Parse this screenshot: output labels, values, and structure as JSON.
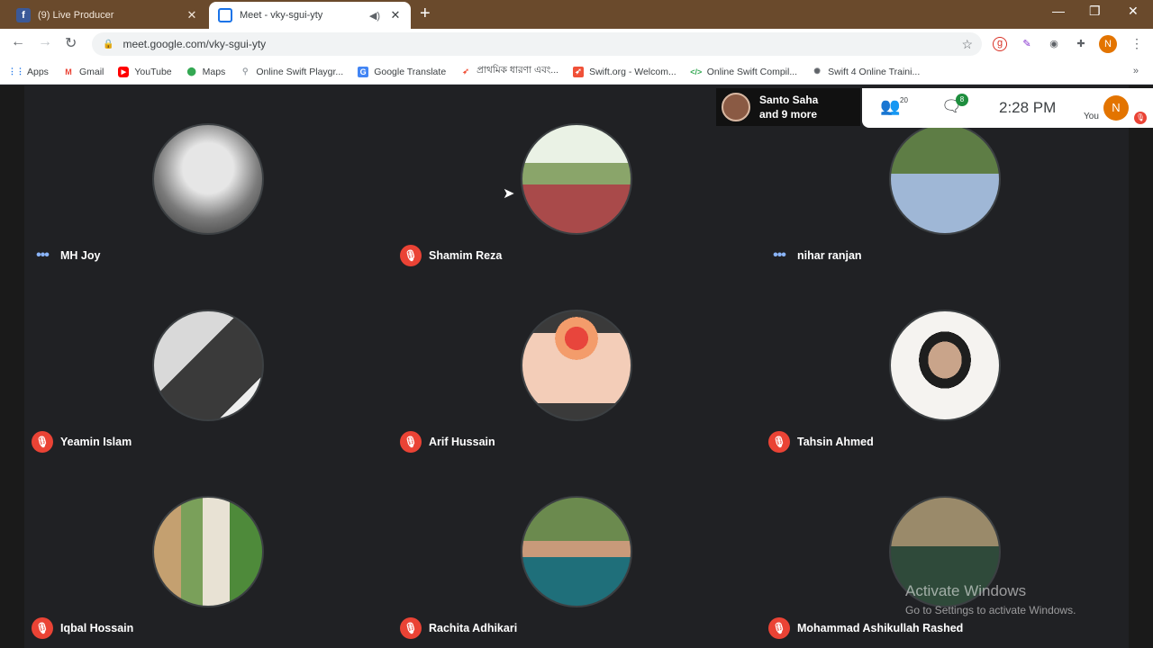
{
  "browser": {
    "tabs": [
      {
        "title": "(9) Live Producer",
        "active": false
      },
      {
        "title": "Meet - vky-sgui-yty",
        "active": true
      }
    ],
    "url": "meet.google.com/vky-sgui-yty",
    "profile_initial": "N",
    "bookmarks": [
      {
        "label": "Apps",
        "icon": "apps-grid-icon"
      },
      {
        "label": "Gmail",
        "icon": "gmail-icon"
      },
      {
        "label": "YouTube",
        "icon": "youtube-icon"
      },
      {
        "label": "Maps",
        "icon": "maps-pin-icon"
      },
      {
        "label": "Online Swift Playgr...",
        "icon": "pin-icon"
      },
      {
        "label": "Google Translate",
        "icon": "translate-icon"
      },
      {
        "label": "প্রাথমিক ধারণা এবং...",
        "icon": "swift-icon"
      },
      {
        "label": "Swift.org - Welcom...",
        "icon": "swift-org-icon"
      },
      {
        "label": "Online Swift Compil...",
        "icon": "code-icon"
      },
      {
        "label": "Swift 4 Online Traini...",
        "icon": "gear-icon"
      }
    ]
  },
  "meet": {
    "presenter": {
      "name": "Santo Saha",
      "more": "and 9 more"
    },
    "people_count": "20",
    "chat_badge": "8",
    "time": "2:28 PM",
    "you_label": "You",
    "you_initial": "N",
    "participants": [
      {
        "name": "MH Joy",
        "status": "speaking",
        "color": "#9a9a9a"
      },
      {
        "name": "Shamim Reza",
        "status": "muted",
        "color": "#7b8f5a"
      },
      {
        "name": "nihar ranjan",
        "status": "speaking",
        "color": "#6f8c52"
      },
      {
        "name": "Yeamin Islam",
        "status": "muted",
        "color": "#bdbdbd"
      },
      {
        "name": "Arif Hussain",
        "status": "muted",
        "color": "#e8c3b0"
      },
      {
        "name": "Tahsin Ahmed",
        "status": "muted",
        "color": "#f3f0ec"
      },
      {
        "name": "Iqbal Hossain",
        "status": "muted",
        "color": "#b7a48a"
      },
      {
        "name": "Rachita Adhikari",
        "status": "muted",
        "color": "#7a9a6a"
      },
      {
        "name": "Mohammad Ashikullah Rashed",
        "status": "muted",
        "color": "#8a7858"
      }
    ]
  },
  "watermark": {
    "line1": "Activate Windows",
    "line2": "Go to Settings to activate Windows."
  }
}
